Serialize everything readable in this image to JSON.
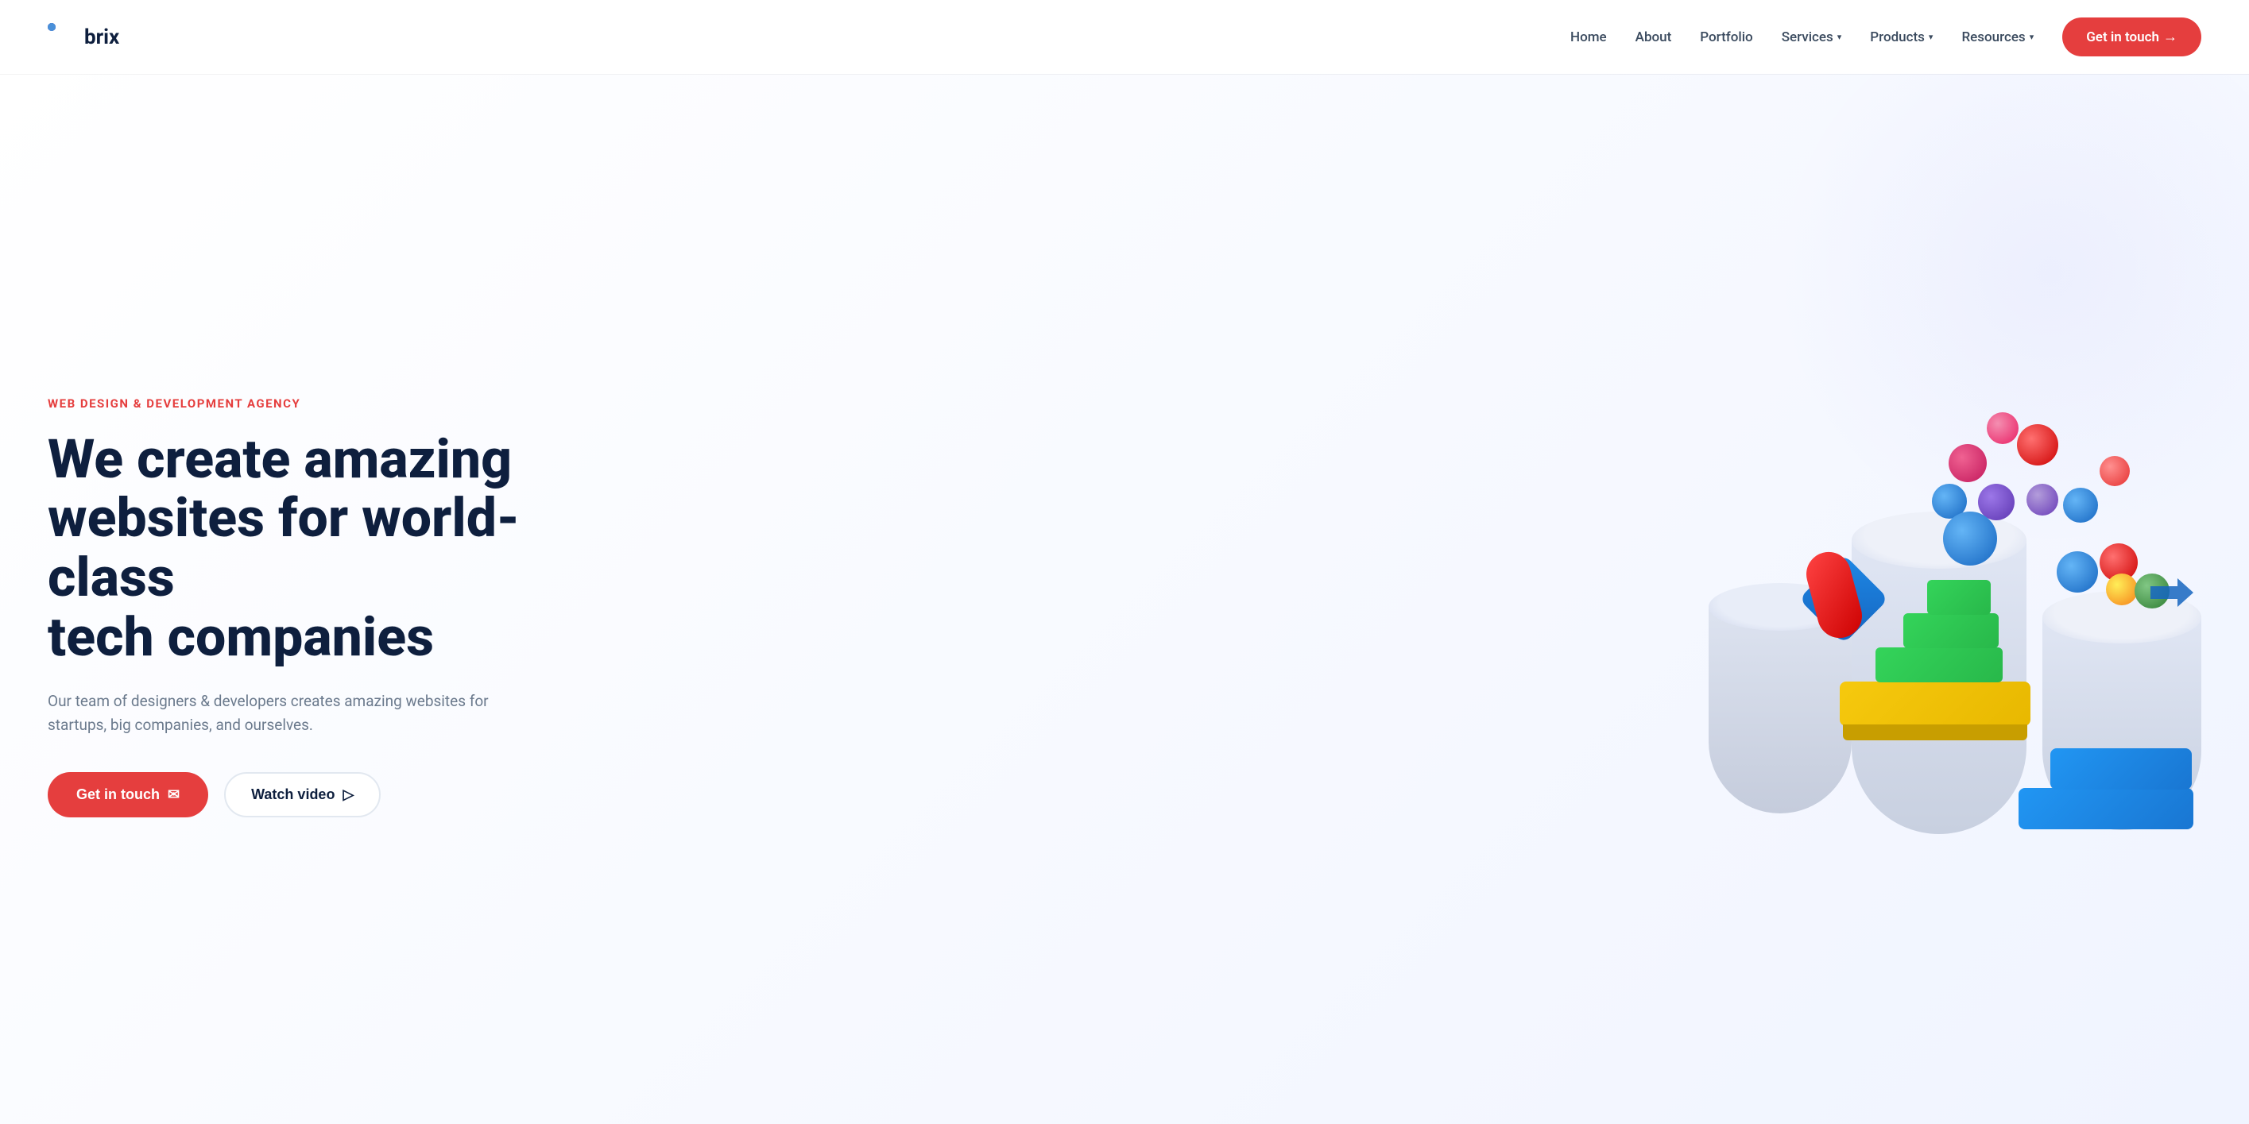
{
  "logo": {
    "text": "brix",
    "dots": [
      "red",
      "red",
      "empty",
      "blue",
      "purple",
      "blue",
      "empty",
      "blue",
      "empty"
    ]
  },
  "nav": {
    "home": "Home",
    "about": "About",
    "portfolio": "Portfolio",
    "services": "Services",
    "products": "Products",
    "resources": "Resources",
    "cta": "Get in touch",
    "cta_arrow": "→"
  },
  "hero": {
    "eyebrow": "WEB DESIGN & DEVELOPMENT AGENCY",
    "title_line1": "We create amazing",
    "title_line2": "websites for world-class",
    "title_line3": "tech companies",
    "subtitle": "Our team of designers & developers creates amazing websites for startups, big companies, and ourselves.",
    "cta_primary": "Get in touch",
    "cta_primary_icon": "✉",
    "cta_secondary": "Watch video",
    "cta_secondary_icon": "▷"
  },
  "colors": {
    "accent_red": "#e53e3e",
    "nav_text": "#3a4a5e",
    "hero_title": "#0e1f3e",
    "hero_sub": "#6b7a8d",
    "logo_text": "#0e1f3e"
  }
}
